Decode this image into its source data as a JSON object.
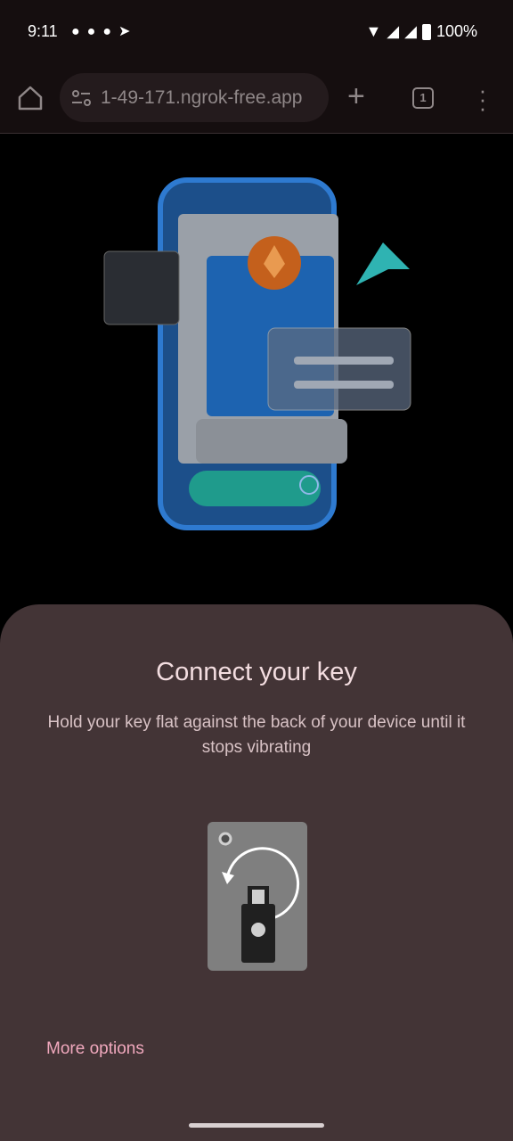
{
  "status_bar": {
    "time": "9:11",
    "notification_icons": [
      "discord-icon",
      "discord-icon",
      "discord-icon",
      "telegram-icon"
    ],
    "battery": "100%"
  },
  "browser": {
    "url": "1-49-171.ngrok-free.app",
    "tab_count": "1"
  },
  "sheet": {
    "title": "Connect your key",
    "description": "Hold your key flat against the back of your device until it stops vibrating",
    "more_options": "More options"
  },
  "colors": {
    "sheet_bg": "#433436",
    "accent": "#f0a8bd"
  }
}
